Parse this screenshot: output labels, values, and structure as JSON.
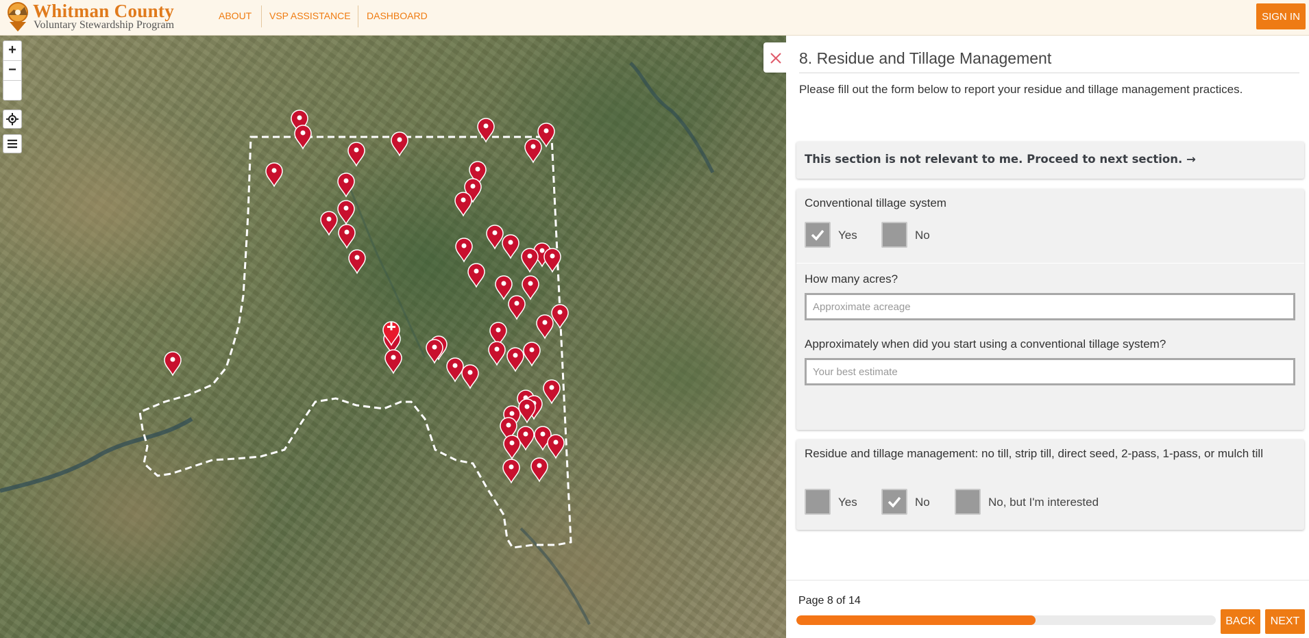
{
  "header": {
    "brand_title": "Whitman County",
    "brand_subtitle": "Voluntary Stewardship Program",
    "nav": [
      "ABOUT",
      "VSP ASSISTANCE",
      "DASHBOARD"
    ],
    "signin_label": "SIGN IN"
  },
  "map": {
    "zoom_in": "+",
    "zoom_out": "−",
    "marker_color": "#c8102e",
    "boundary_style": "white dashed",
    "basemap": "satellite"
  },
  "panel": {
    "title": "8. Residue and Tillage Management",
    "intro": "Please fill out the form below to report your residue and tillage management practices.",
    "skip_label": "This section is not relevant to me. Proceed to next section. →",
    "q1": {
      "label": "Conventional tillage system",
      "options": [
        {
          "label": "Yes",
          "checked": true
        },
        {
          "label": "No",
          "checked": false
        }
      ]
    },
    "q2": {
      "label": "How many acres?",
      "placeholder": "Approximate acreage"
    },
    "q3": {
      "label": "Approximately when did you start using a conventional tillage system?",
      "placeholder": "Your best estimate"
    },
    "q4": {
      "label": "Residue and tillage management: no till, strip till, direct seed, 2-pass, 1-pass, or mulch till",
      "options": [
        {
          "label": "Yes",
          "checked": false
        },
        {
          "label": "No",
          "checked": true
        },
        {
          "label": "No, but I'm interested",
          "checked": false
        }
      ]
    }
  },
  "footer": {
    "page_text": "Page 8 of 14",
    "progress": 0.571,
    "back_label": "BACK",
    "next_label": "NEXT"
  },
  "colors": {
    "accent": "#ee7b14",
    "progress": "#f47516"
  }
}
